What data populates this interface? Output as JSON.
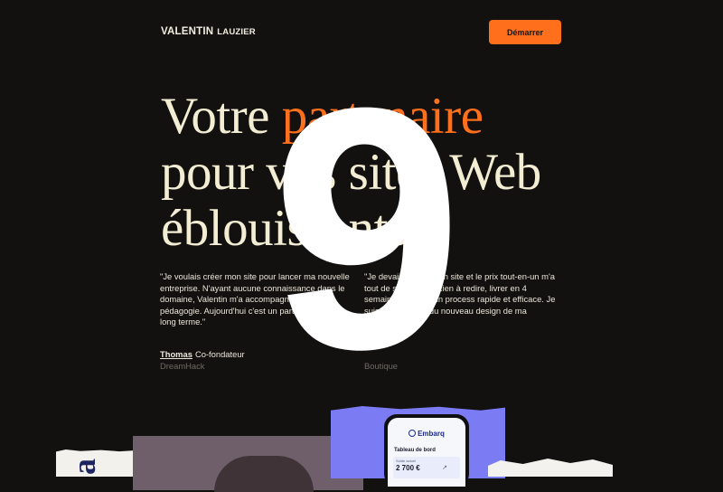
{
  "nav": {
    "logo_first": "VALENTIN",
    "logo_last": "LAUZIER",
    "cta_label": "Démarrer"
  },
  "hero": {
    "title_start": "Votre ",
    "title_accent": "partenaire",
    "title_line2": "pour vos sites Web",
    "title_line3": "éblouissants"
  },
  "testimonials": [
    {
      "quote": "\"Je voulais créer mon site pour lancer ma nouvelle entreprise. N'ayant aucune connaissance dans le domaine, Valentin m'a accompagné avec pédagogie. Aujourd'hui c'est un partenaire sur le long terme.\"",
      "name": "Thomas",
      "role": "Co-fondateur",
      "company": "DreamHack"
    },
    {
      "quote": "\"Je devais refaire mon site et le prix tout-en-un m'a tout de suite attiré. Rien à redire, livrer en 4 semaines grâce à un process rapide et efficace. Je suis très satisfait du nouveau design de ma boutique.\"",
      "name": "",
      "role": "",
      "company": "Boutique"
    }
  ],
  "overlay": {
    "number": "9"
  },
  "mockup": {
    "brand": "Embarq",
    "dashboard_title": "Tableau de bord",
    "card_sub": "Solde actuel",
    "card_amount": "2 700 €",
    "card_arrow": "↗"
  },
  "collage": {
    "glyph": "a"
  },
  "colors": {
    "background": "#121110",
    "accent": "#ff6f1c",
    "headline": "#f3edd3",
    "purple": "#7b7bf4"
  }
}
